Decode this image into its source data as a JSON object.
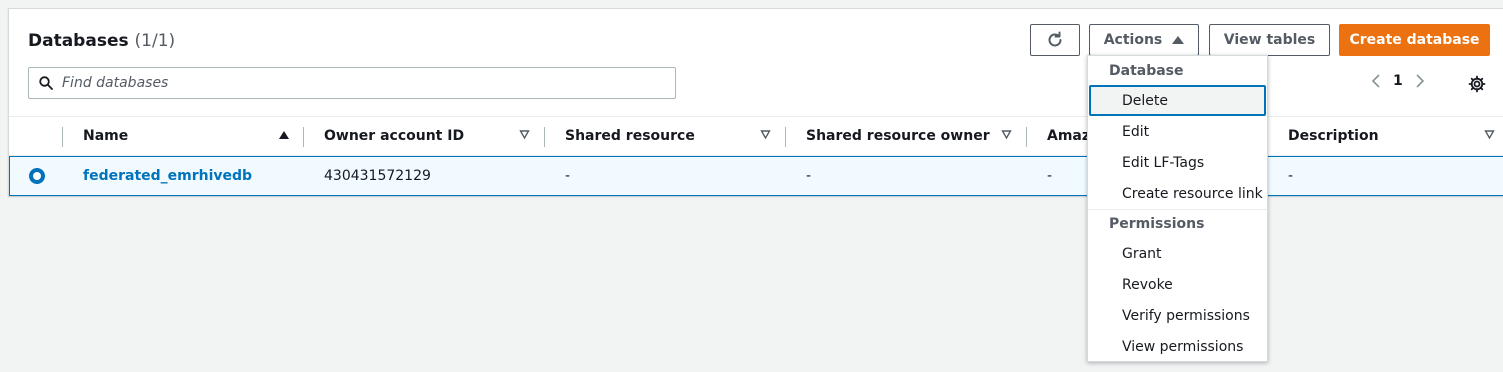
{
  "header": {
    "title": "Databases",
    "count": "(1/1)"
  },
  "toolbar": {
    "actions_label": "Actions",
    "view_tables_label": "View tables",
    "create_database_label": "Create database"
  },
  "search": {
    "placeholder": "Find databases"
  },
  "pagination": {
    "current_page": "1"
  },
  "table": {
    "columns": [
      "Name",
      "Owner account ID",
      "Shared resource",
      "Shared resource owner",
      "Amazon",
      "Description"
    ],
    "rows": [
      {
        "name": "federated_emrhivedb",
        "owner_account_id": "430431572129",
        "shared_resource": "-",
        "shared_resource_owner": "-",
        "amazon": "-",
        "description": "-"
      }
    ]
  },
  "actions_menu": {
    "groups": [
      {
        "header": "Database",
        "items": [
          "Delete",
          "Edit",
          "Edit LF-Tags",
          "Create resource link"
        ]
      },
      {
        "header": "Permissions",
        "items": [
          "Grant",
          "Revoke",
          "Verify permissions",
          "View permissions"
        ]
      }
    ]
  },
  "colors": {
    "primary": "#ec7211",
    "link": "#0073bb",
    "selected_row_bg": "#f1faff"
  }
}
